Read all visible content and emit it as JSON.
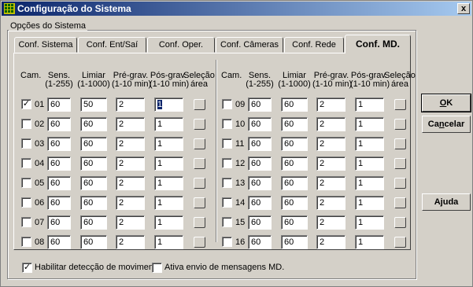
{
  "window": {
    "title": "Configuração do Sistema",
    "close_label": "x"
  },
  "group": {
    "label": "Opções do Sistema"
  },
  "tabs": [
    {
      "label": "Conf. Sistema",
      "active": false
    },
    {
      "label": "Conf. Ent/Saí",
      "active": false
    },
    {
      "label": "Conf. Oper.",
      "active": false
    },
    {
      "label": "Conf. Câmeras",
      "active": false
    },
    {
      "label": "Conf. Rede",
      "active": false
    },
    {
      "label": "Conf. MD.",
      "active": true
    }
  ],
  "headers": {
    "cam": "Cam.",
    "sens": [
      "Sens.",
      "(1-255)"
    ],
    "limiar": [
      "Limiar",
      "(1-1000)"
    ],
    "pregrav": [
      "Pré-grav.",
      "(1-10 min)"
    ],
    "posgrav": [
      "Pós-grav.",
      "(1-10 min)"
    ],
    "area": [
      "Seleção",
      "área"
    ]
  },
  "cameras": [
    {
      "num": "01",
      "checked": true,
      "sens": "60",
      "limiar": "50",
      "pre": "2",
      "pos": "1"
    },
    {
      "num": "02",
      "checked": false,
      "sens": "60",
      "limiar": "60",
      "pre": "2",
      "pos": "1"
    },
    {
      "num": "03",
      "checked": false,
      "sens": "60",
      "limiar": "60",
      "pre": "2",
      "pos": "1"
    },
    {
      "num": "04",
      "checked": false,
      "sens": "60",
      "limiar": "60",
      "pre": "2",
      "pos": "1"
    },
    {
      "num": "05",
      "checked": false,
      "sens": "60",
      "limiar": "60",
      "pre": "2",
      "pos": "1"
    },
    {
      "num": "06",
      "checked": false,
      "sens": "60",
      "limiar": "60",
      "pre": "2",
      "pos": "1"
    },
    {
      "num": "07",
      "checked": false,
      "sens": "60",
      "limiar": "60",
      "pre": "2",
      "pos": "1"
    },
    {
      "num": "08",
      "checked": false,
      "sens": "60",
      "limiar": "60",
      "pre": "2",
      "pos": "1"
    },
    {
      "num": "09",
      "checked": false,
      "sens": "60",
      "limiar": "60",
      "pre": "2",
      "pos": "1"
    },
    {
      "num": "10",
      "checked": false,
      "sens": "60",
      "limiar": "60",
      "pre": "2",
      "pos": "1"
    },
    {
      "num": "11",
      "checked": false,
      "sens": "60",
      "limiar": "60",
      "pre": "2",
      "pos": "1"
    },
    {
      "num": "12",
      "checked": false,
      "sens": "60",
      "limiar": "60",
      "pre": "2",
      "pos": "1"
    },
    {
      "num": "13",
      "checked": false,
      "sens": "60",
      "limiar": "60",
      "pre": "2",
      "pos": "1"
    },
    {
      "num": "14",
      "checked": false,
      "sens": "60",
      "limiar": "60",
      "pre": "2",
      "pos": "1"
    },
    {
      "num": "15",
      "checked": false,
      "sens": "60",
      "limiar": "60",
      "pre": "2",
      "pos": "1"
    },
    {
      "num": "16",
      "checked": false,
      "sens": "60",
      "limiar": "60",
      "pre": "2",
      "pos": "1"
    }
  ],
  "options": {
    "enable_md_label": "Habilitar detecção de movimento",
    "enable_md_checked": true,
    "send_md_label": "Ativa envio de mensagens MD.",
    "send_md_checked": false
  },
  "buttons": {
    "ok_accel": "O",
    "ok_rest": "K",
    "cancel_pre": "Ca",
    "cancel_accel": "n",
    "cancel_rest": "celar",
    "help": "Ajuda"
  },
  "colors": {
    "title_start": "#0a246a",
    "title_end": "#a6caf0",
    "face": "#d4d0c8"
  }
}
